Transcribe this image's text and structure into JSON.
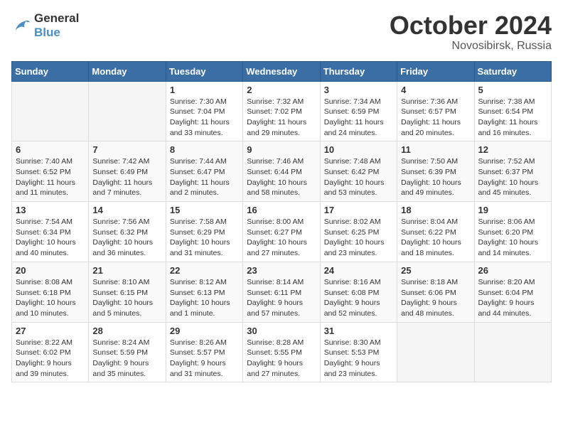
{
  "header": {
    "logo_line1": "General",
    "logo_line2": "Blue",
    "month": "October 2024",
    "location": "Novosibirsk, Russia"
  },
  "days_of_week": [
    "Sunday",
    "Monday",
    "Tuesday",
    "Wednesday",
    "Thursday",
    "Friday",
    "Saturday"
  ],
  "weeks": [
    [
      {
        "day": "",
        "sunrise": "",
        "sunset": "",
        "daylight": ""
      },
      {
        "day": "",
        "sunrise": "",
        "sunset": "",
        "daylight": ""
      },
      {
        "day": "1",
        "sunrise": "Sunrise: 7:30 AM",
        "sunset": "Sunset: 7:04 PM",
        "daylight": "Daylight: 11 hours and 33 minutes."
      },
      {
        "day": "2",
        "sunrise": "Sunrise: 7:32 AM",
        "sunset": "Sunset: 7:02 PM",
        "daylight": "Daylight: 11 hours and 29 minutes."
      },
      {
        "day": "3",
        "sunrise": "Sunrise: 7:34 AM",
        "sunset": "Sunset: 6:59 PM",
        "daylight": "Daylight: 11 hours and 24 minutes."
      },
      {
        "day": "4",
        "sunrise": "Sunrise: 7:36 AM",
        "sunset": "Sunset: 6:57 PM",
        "daylight": "Daylight: 11 hours and 20 minutes."
      },
      {
        "day": "5",
        "sunrise": "Sunrise: 7:38 AM",
        "sunset": "Sunset: 6:54 PM",
        "daylight": "Daylight: 11 hours and 16 minutes."
      }
    ],
    [
      {
        "day": "6",
        "sunrise": "Sunrise: 7:40 AM",
        "sunset": "Sunset: 6:52 PM",
        "daylight": "Daylight: 11 hours and 11 minutes."
      },
      {
        "day": "7",
        "sunrise": "Sunrise: 7:42 AM",
        "sunset": "Sunset: 6:49 PM",
        "daylight": "Daylight: 11 hours and 7 minutes."
      },
      {
        "day": "8",
        "sunrise": "Sunrise: 7:44 AM",
        "sunset": "Sunset: 6:47 PM",
        "daylight": "Daylight: 11 hours and 2 minutes."
      },
      {
        "day": "9",
        "sunrise": "Sunrise: 7:46 AM",
        "sunset": "Sunset: 6:44 PM",
        "daylight": "Daylight: 10 hours and 58 minutes."
      },
      {
        "day": "10",
        "sunrise": "Sunrise: 7:48 AM",
        "sunset": "Sunset: 6:42 PM",
        "daylight": "Daylight: 10 hours and 53 minutes."
      },
      {
        "day": "11",
        "sunrise": "Sunrise: 7:50 AM",
        "sunset": "Sunset: 6:39 PM",
        "daylight": "Daylight: 10 hours and 49 minutes."
      },
      {
        "day": "12",
        "sunrise": "Sunrise: 7:52 AM",
        "sunset": "Sunset: 6:37 PM",
        "daylight": "Daylight: 10 hours and 45 minutes."
      }
    ],
    [
      {
        "day": "13",
        "sunrise": "Sunrise: 7:54 AM",
        "sunset": "Sunset: 6:34 PM",
        "daylight": "Daylight: 10 hours and 40 minutes."
      },
      {
        "day": "14",
        "sunrise": "Sunrise: 7:56 AM",
        "sunset": "Sunset: 6:32 PM",
        "daylight": "Daylight: 10 hours and 36 minutes."
      },
      {
        "day": "15",
        "sunrise": "Sunrise: 7:58 AM",
        "sunset": "Sunset: 6:29 PM",
        "daylight": "Daylight: 10 hours and 31 minutes."
      },
      {
        "day": "16",
        "sunrise": "Sunrise: 8:00 AM",
        "sunset": "Sunset: 6:27 PM",
        "daylight": "Daylight: 10 hours and 27 minutes."
      },
      {
        "day": "17",
        "sunrise": "Sunrise: 8:02 AM",
        "sunset": "Sunset: 6:25 PM",
        "daylight": "Daylight: 10 hours and 23 minutes."
      },
      {
        "day": "18",
        "sunrise": "Sunrise: 8:04 AM",
        "sunset": "Sunset: 6:22 PM",
        "daylight": "Daylight: 10 hours and 18 minutes."
      },
      {
        "day": "19",
        "sunrise": "Sunrise: 8:06 AM",
        "sunset": "Sunset: 6:20 PM",
        "daylight": "Daylight: 10 hours and 14 minutes."
      }
    ],
    [
      {
        "day": "20",
        "sunrise": "Sunrise: 8:08 AM",
        "sunset": "Sunset: 6:18 PM",
        "daylight": "Daylight: 10 hours and 10 minutes."
      },
      {
        "day": "21",
        "sunrise": "Sunrise: 8:10 AM",
        "sunset": "Sunset: 6:15 PM",
        "daylight": "Daylight: 10 hours and 5 minutes."
      },
      {
        "day": "22",
        "sunrise": "Sunrise: 8:12 AM",
        "sunset": "Sunset: 6:13 PM",
        "daylight": "Daylight: 10 hours and 1 minute."
      },
      {
        "day": "23",
        "sunrise": "Sunrise: 8:14 AM",
        "sunset": "Sunset: 6:11 PM",
        "daylight": "Daylight: 9 hours and 57 minutes."
      },
      {
        "day": "24",
        "sunrise": "Sunrise: 8:16 AM",
        "sunset": "Sunset: 6:08 PM",
        "daylight": "Daylight: 9 hours and 52 minutes."
      },
      {
        "day": "25",
        "sunrise": "Sunrise: 8:18 AM",
        "sunset": "Sunset: 6:06 PM",
        "daylight": "Daylight: 9 hours and 48 minutes."
      },
      {
        "day": "26",
        "sunrise": "Sunrise: 8:20 AM",
        "sunset": "Sunset: 6:04 PM",
        "daylight": "Daylight: 9 hours and 44 minutes."
      }
    ],
    [
      {
        "day": "27",
        "sunrise": "Sunrise: 8:22 AM",
        "sunset": "Sunset: 6:02 PM",
        "daylight": "Daylight: 9 hours and 39 minutes."
      },
      {
        "day": "28",
        "sunrise": "Sunrise: 8:24 AM",
        "sunset": "Sunset: 5:59 PM",
        "daylight": "Daylight: 9 hours and 35 minutes."
      },
      {
        "day": "29",
        "sunrise": "Sunrise: 8:26 AM",
        "sunset": "Sunset: 5:57 PM",
        "daylight": "Daylight: 9 hours and 31 minutes."
      },
      {
        "day": "30",
        "sunrise": "Sunrise: 8:28 AM",
        "sunset": "Sunset: 5:55 PM",
        "daylight": "Daylight: 9 hours and 27 minutes."
      },
      {
        "day": "31",
        "sunrise": "Sunrise: 8:30 AM",
        "sunset": "Sunset: 5:53 PM",
        "daylight": "Daylight: 9 hours and 23 minutes."
      },
      {
        "day": "",
        "sunrise": "",
        "sunset": "",
        "daylight": ""
      },
      {
        "day": "",
        "sunrise": "",
        "sunset": "",
        "daylight": ""
      }
    ]
  ]
}
